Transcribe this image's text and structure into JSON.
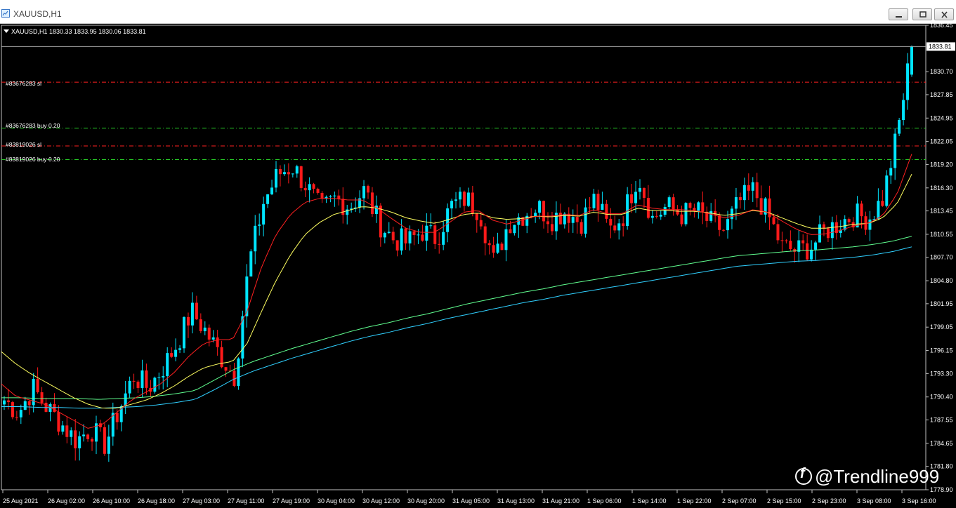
{
  "window": {
    "title": "XAUUSD,H1",
    "buttons": [
      "minimize",
      "restore",
      "close"
    ]
  },
  "header": {
    "symbol_info": "XAUUSD,H1  1830.33 1833.95 1830.06 1833.81"
  },
  "price_axis": {
    "labels": [
      "1836.45",
      "1833.81",
      "1830.70",
      "1827.85",
      "1824.95",
      "1822.05",
      "1819.20",
      "1816.30",
      "1813.45",
      "1810.55",
      "1807.70",
      "1804.80",
      "1801.95",
      "1799.05",
      "1796.15",
      "1793.30",
      "1790.40",
      "1787.55",
      "1784.65",
      "1781.80",
      "1778.90"
    ],
    "current_price": "1833.81"
  },
  "time_axis": {
    "labels": [
      "25 Aug 2021",
      "26 Aug 02:00",
      "26 Aug 10:00",
      "26 Aug 18:00",
      "27 Aug 03:00",
      "27 Aug 11:00",
      "27 Aug 19:00",
      "30 Aug 04:00",
      "30 Aug 12:00",
      "30 Aug 20:00",
      "31 Aug 05:00",
      "31 Aug 13:00",
      "31 Aug 21:00",
      "1 Sep 06:00",
      "1 Sep 14:00",
      "1 Sep 22:00",
      "2 Sep 07:00",
      "2 Sep 15:00",
      "2 Sep 23:00",
      "3 Sep 08:00",
      "3 Sep 16:00"
    ]
  },
  "order_lines": [
    {
      "label": "#83676283 sl",
      "price": 1829.4,
      "color": "#ff2020"
    },
    {
      "label": "#83676283 buy 0.20",
      "price": 1823.7,
      "color": "#28d028"
    },
    {
      "label": "#83819026 sl",
      "price": 1821.5,
      "color": "#ff2020"
    },
    {
      "label": "#83819026 buy 0.20",
      "price": 1819.8,
      "color": "#28d028"
    }
  ],
  "colors": {
    "bull": "#00e5ff",
    "bear": "#ff1a1a",
    "ma_fast": "#ff2020",
    "ma_slow": "#ffff60",
    "ma_long1": "#60ff90",
    "ma_long2": "#30d0ff",
    "grid_bg": "#000000"
  },
  "watermark": "@Trendline999",
  "chart_data": {
    "type": "candlestick",
    "symbol": "XAUUSD",
    "timeframe": "H1",
    "ylim": [
      1778.9,
      1836.45
    ],
    "last": {
      "open": 1830.33,
      "high": 1833.95,
      "low": 1830.06,
      "close": 1833.81
    },
    "x": [
      "25 Aug 2021",
      "26 Aug 02:00",
      "26 Aug 10:00",
      "26 Aug 18:00",
      "27 Aug 03:00",
      "27 Aug 11:00",
      "27 Aug 19:00",
      "30 Aug 04:00",
      "30 Aug 12:00",
      "30 Aug 20:00",
      "31 Aug 05:00",
      "31 Aug 13:00",
      "31 Aug 21:00",
      "1 Sep 06:00",
      "1 Sep 14:00",
      "1 Sep 22:00",
      "2 Sep 07:00",
      "2 Sep 15:00",
      "2 Sep 23:00",
      "3 Sep 08:00",
      "3 Sep 16:00"
    ],
    "close_path": [
      1790.0,
      1788.5,
      1791.5,
      1789.0,
      1787.0,
      1785.0,
      1786.5,
      1784.5,
      1789.0,
      1793.0,
      1791.5,
      1794.0,
      1797.0,
      1801.0,
      1798.5,
      1795.5,
      1793.0,
      1807.0,
      1814.5,
      1818.0,
      1819.0,
      1816.5,
      1813.5,
      1815.0,
      1814.0,
      1816.0,
      1812.0,
      1810.0,
      1809.5,
      1811.0,
      1810.0,
      1814.0,
      1815.0,
      1813.5,
      1807.0,
      1812.0,
      1813.0,
      1814.0,
      1812.5,
      1813.5,
      1812.0,
      1815.0,
      1811.0,
      1813.0,
      1818.0,
      1812.5,
      1814.0,
      1813.0,
      1813.5,
      1812.0,
      1811.0,
      1814.5,
      1816.0,
      1813.0,
      1809.0,
      1808.5,
      1809.0,
      1811.0,
      1812.0,
      1813.0,
      1812.5,
      1815.0,
      1823.0,
      1833.8
    ],
    "ma_fast": [
      1792.0,
      1790.5,
      1790.0,
      1789.5,
      1788.5,
      1787.5,
      1786.5,
      1787.0,
      1788.5,
      1790.0,
      1791.0,
      1792.0,
      1793.5,
      1795.5,
      1797.0,
      1797.5,
      1797.5,
      1801.0,
      1806.5,
      1810.5,
      1813.0,
      1814.5,
      1815.0,
      1815.0,
      1814.8,
      1814.8,
      1813.8,
      1812.5,
      1811.3,
      1810.8,
      1810.8,
      1812.0,
      1813.3,
      1813.5,
      1812.3,
      1811.8,
      1812.3,
      1812.8,
      1812.8,
      1813.0,
      1812.9,
      1813.6,
      1813.1,
      1813.1,
      1814.2,
      1813.8,
      1813.6,
      1813.6,
      1813.5,
      1813.1,
      1812.6,
      1812.9,
      1813.6,
      1813.3,
      1812.2,
      1811.2,
      1810.5,
      1810.6,
      1811.0,
      1811.6,
      1811.9,
      1812.9,
      1815.6,
      1820.5
    ],
    "ma_slow": [
      1796.0,
      1794.5,
      1793.3,
      1792.3,
      1791.3,
      1790.3,
      1789.5,
      1789.0,
      1789.0,
      1789.5,
      1790.0,
      1790.8,
      1791.8,
      1793.0,
      1794.0,
      1794.5,
      1794.8,
      1797.0,
      1801.0,
      1804.8,
      1808.0,
      1810.5,
      1812.0,
      1813.0,
      1813.5,
      1814.0,
      1813.8,
      1813.3,
      1812.6,
      1812.2,
      1811.9,
      1812.4,
      1813.0,
      1813.2,
      1812.6,
      1812.4,
      1812.5,
      1812.8,
      1812.7,
      1812.9,
      1812.8,
      1813.3,
      1813.0,
      1813.0,
      1813.8,
      1813.5,
      1813.5,
      1813.4,
      1813.4,
      1813.2,
      1812.9,
      1813.1,
      1813.5,
      1813.3,
      1812.6,
      1811.9,
      1811.3,
      1811.3,
      1811.5,
      1811.8,
      1811.9,
      1812.6,
      1814.4,
      1818.0
    ],
    "ma_long1": [
      1790.3,
      1790.3,
      1790.2,
      1790.2,
      1790.2,
      1790.1,
      1790.2,
      1790.3,
      1790.5,
      1790.8,
      1791.2,
      1792.5,
      1793.8,
      1794.8,
      1795.6,
      1796.4,
      1797.1,
      1797.8,
      1798.5,
      1799.1,
      1799.6,
      1800.2,
      1800.7,
      1801.3,
      1801.9,
      1802.4,
      1802.9,
      1803.4,
      1803.8,
      1804.3,
      1804.7,
      1805.1,
      1805.5,
      1805.9,
      1806.3,
      1806.7,
      1807.1,
      1807.5,
      1807.9,
      1808.1,
      1808.3,
      1808.5,
      1808.6,
      1808.8,
      1809.0,
      1809.3,
      1809.7,
      1810.3
    ],
    "ma_long2": [
      1789.2,
      1789.2,
      1789.1,
      1789.1,
      1789.0,
      1789.0,
      1789.1,
      1789.2,
      1789.4,
      1789.7,
      1790.1,
      1791.3,
      1792.6,
      1793.6,
      1794.4,
      1795.2,
      1795.9,
      1796.6,
      1797.3,
      1797.9,
      1798.4,
      1799.0,
      1799.5,
      1800.1,
      1800.6,
      1801.1,
      1801.6,
      1802.1,
      1802.5,
      1803.0,
      1803.4,
      1803.8,
      1804.2,
      1804.6,
      1805.0,
      1805.4,
      1805.8,
      1806.2,
      1806.6,
      1806.8,
      1807.0,
      1807.2,
      1807.3,
      1807.5,
      1807.7,
      1808.0,
      1808.4,
      1809.0
    ],
    "ylabel": "",
    "xlabel": "",
    "grid": false
  }
}
